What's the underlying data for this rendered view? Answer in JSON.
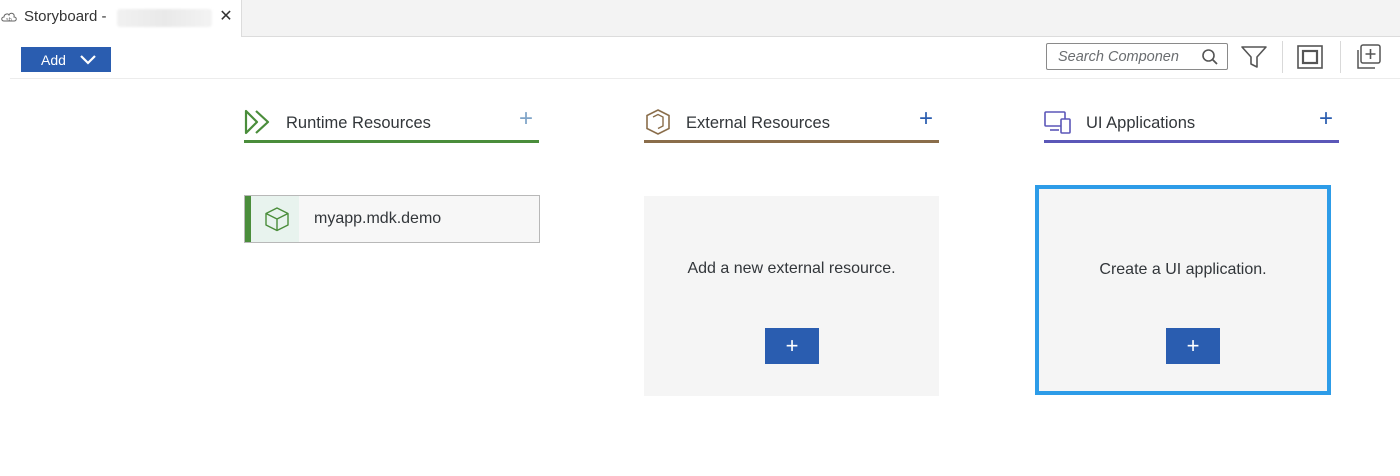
{
  "tab": {
    "title": "Storyboard -",
    "close": "✕"
  },
  "toolbar": {
    "add_label": "Add",
    "search_placeholder": "Search Componen"
  },
  "columns": {
    "runtime": {
      "title": "Runtime Resources",
      "plus": "+",
      "color": "#4a8d3b",
      "plus_color": "#7fa4c8"
    },
    "external": {
      "title": "External Resources",
      "plus": "+",
      "color": "#8a6d4a",
      "plus_color": "#2a5db0"
    },
    "ui": {
      "title": "UI Applications",
      "plus": "+",
      "color": "#5b57b8",
      "plus_color": "#2a5db0"
    }
  },
  "runtime_card": {
    "name": "myapp.mdk.demo"
  },
  "external_placeholder": {
    "text": "Add a new external resource.",
    "button": "+"
  },
  "ui_placeholder": {
    "text": "Create a UI application.",
    "button": "+"
  },
  "colors": {
    "primary": "#2a5db0",
    "selection": "#2d9ce8"
  },
  "icons": [
    "cloud-icon",
    "close-icon",
    "chevron-down-icon",
    "search-icon",
    "filter-icon",
    "fit-to-screen-icon",
    "add-frame-icon",
    "runtime-forward-icon",
    "hexagon-icon",
    "devices-icon",
    "cube-icon"
  ]
}
